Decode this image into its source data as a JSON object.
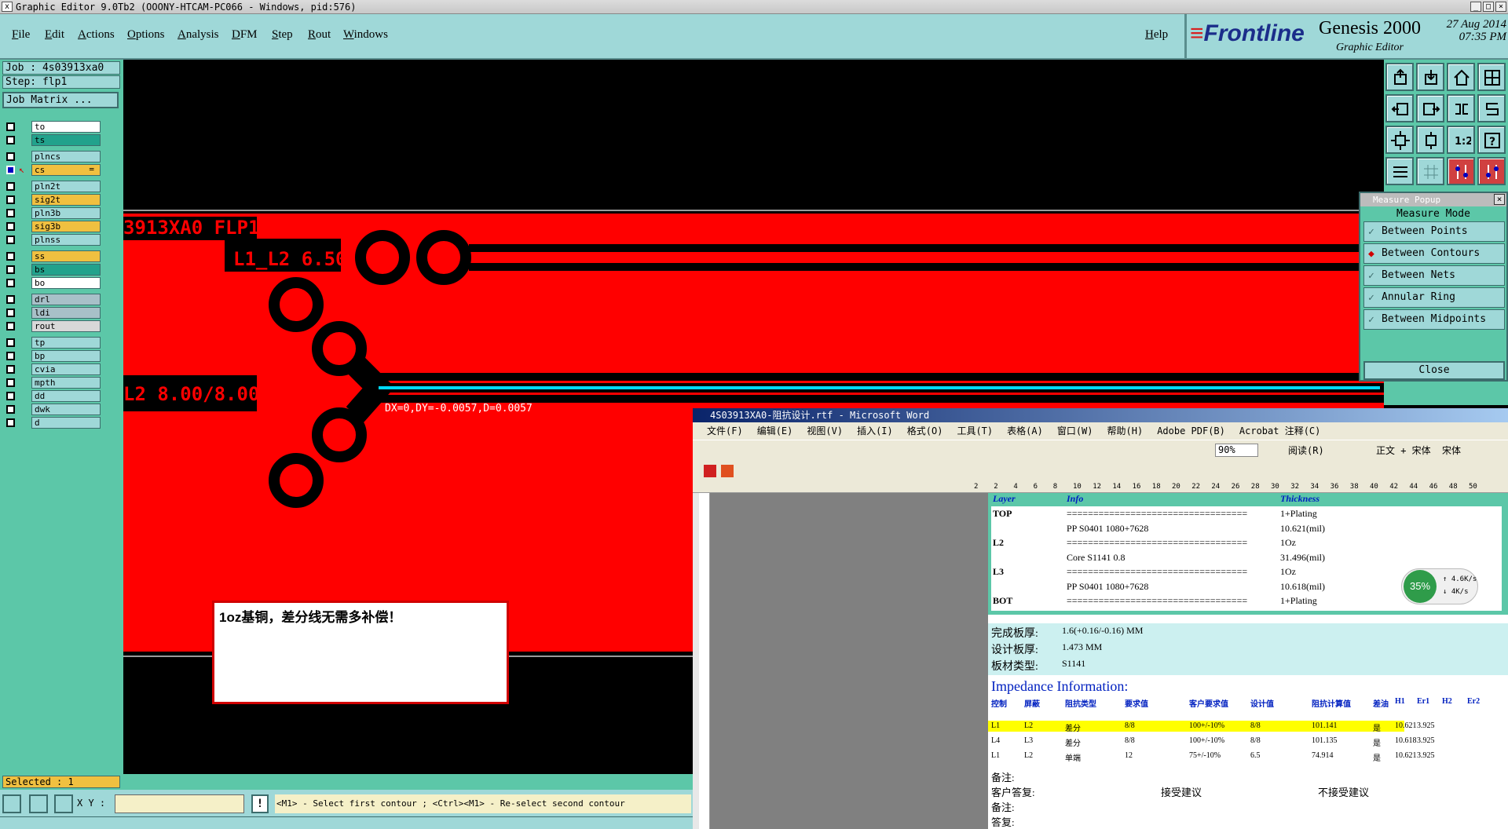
{
  "titlebar": {
    "title": "Graphic Editor 9.0Tb2 (OOONY-HTCAM-PC066 - Windows, pid:576)"
  },
  "menu": {
    "items": [
      "File",
      "Edit",
      "Actions",
      "Options",
      "Analysis",
      "DFM",
      "Step",
      "Rout",
      "Windows"
    ],
    "help": "Help"
  },
  "brand": {
    "logo": "Frontline",
    "product": "Genesis 2000",
    "subtitle": "Graphic Editor",
    "date": "27 Aug 2014",
    "time": "07:35 PM"
  },
  "job": {
    "job_label": "Job : 4s03913xa0",
    "step_label": "Step: flp1",
    "matrix_button": "Job Matrix ..."
  },
  "layers": [
    {
      "name": "to",
      "color": "#ffffff",
      "checked": false
    },
    {
      "name": "ts",
      "color": "#22a28c",
      "checked": false
    },
    {
      "name": "plncs",
      "color": "#9fd8d8",
      "checked": false
    },
    {
      "name": "cs",
      "color": "#f0c040",
      "checked": true,
      "marker": "="
    },
    {
      "name": "pln2t",
      "color": "#9fd8d8",
      "checked": false
    },
    {
      "name": "sig2t",
      "color": "#f0c040",
      "checked": false
    },
    {
      "name": "pln3b",
      "color": "#9fd8d8",
      "checked": false
    },
    {
      "name": "sig3b",
      "color": "#f0c040",
      "checked": false
    },
    {
      "name": "plnss",
      "color": "#9fd8d8",
      "checked": false
    },
    {
      "name": "ss",
      "color": "#f0c040",
      "checked": false
    },
    {
      "name": "bs",
      "color": "#22a28c",
      "checked": false
    },
    {
      "name": "bo",
      "color": "#ffffff",
      "checked": false
    },
    {
      "name": "drl",
      "color": "#a8c0c8",
      "checked": false
    },
    {
      "name": "ldi",
      "color": "#a8c0c8",
      "checked": false
    },
    {
      "name": "rout",
      "color": "#d8d8d8",
      "checked": false
    },
    {
      "name": "tp",
      "color": "#9fd8d8",
      "checked": false
    },
    {
      "name": "bp",
      "color": "#9fd8d8",
      "checked": false
    },
    {
      "name": "cvia",
      "color": "#9fd8d8",
      "checked": false
    },
    {
      "name": "mpth",
      "color": "#9fd8d8",
      "checked": false
    },
    {
      "name": "dd",
      "color": "#9fd8d8",
      "checked": false
    },
    {
      "name": "dwk",
      "color": "#9fd8d8",
      "checked": false
    },
    {
      "name": "d",
      "color": "#9fd8d8",
      "checked": false
    }
  ],
  "status": {
    "selected": "Selected : 1",
    "xy_label": "X Y :",
    "xy_value": "",
    "prompt": "<M1> - Select first contour ; <Ctrl><M1> - Re-select second contour"
  },
  "canvas": {
    "label1": "3913XA0 FLP1",
    "label2": "L1_L2 6.50",
    "label3": "L2 8.00/8.00",
    "measure_readout": "DX=0,DY=-0.0057,D=0.0057",
    "note": "1oz基铜，差分线无需多补偿！"
  },
  "measure_popup": {
    "title": "Measure Popup",
    "mode_label": "Measure Mode",
    "options": [
      "Between Points",
      "Between Contours",
      "Between Nets",
      "Annular Ring",
      "Between Midpoints"
    ],
    "selected": "Between Contours",
    "close": "Close"
  },
  "word": {
    "title": "4S03913XA0-阻抗设计.rtf - Microsoft Word",
    "menu": [
      "文件(F)",
      "编辑(E)",
      "视图(V)",
      "插入(I)",
      "格式(O)",
      "工具(T)",
      "表格(A)",
      "窗口(W)",
      "帮助(H)",
      "Adobe PDF(B)",
      "Acrobat 注释(C)"
    ],
    "zoom": "90%",
    "read": "阅读(R)",
    "style": "正文 + 宋体",
    "font": "宋体",
    "ruler": [
      "2",
      "2",
      "4",
      "6",
      "8",
      "10",
      "12",
      "14",
      "16",
      "18",
      "20",
      "22",
      "24",
      "26",
      "28",
      "30",
      "32",
      "34",
      "36",
      "38",
      "40",
      "42",
      "44",
      "46",
      "48",
      "50"
    ],
    "stack_headers": [
      "Layer",
      "Info",
      "Thickness"
    ],
    "stack_rows": [
      [
        "TOP",
        "==================================",
        "1+Plating"
      ],
      [
        "",
        "PP    S0401     1080+7628",
        "10.621(mil)"
      ],
      [
        "L2",
        "==================================",
        "1Oz"
      ],
      [
        "",
        "Core     S1141     0.8",
        "31.496(mil)"
      ],
      [
        "L3",
        "==================================",
        "1Oz"
      ],
      [
        "",
        "PP    S0401     1080+7628",
        "10.618(mil)"
      ],
      [
        "BOT",
        "==================================",
        "1+Plating"
      ]
    ],
    "board": [
      [
        "完成板厚:",
        "1.6(+0.16/-0.16) MM"
      ],
      [
        "设计板厚:",
        "1.473 MM"
      ],
      [
        "板材类型:",
        "S1141"
      ]
    ],
    "imp_title": "Impedance Information:",
    "imp_headers": [
      "控制",
      "屏蔽",
      "阻抗类型",
      "要求值",
      "客户要求值",
      "设计值",
      "阻抗计算值",
      "差油",
      "H1",
      "Er1",
      "H2",
      "Er2"
    ],
    "imp_rows": [
      [
        "L1",
        "L2",
        "差分",
        "8/8",
        "100+/-10%",
        "8/8",
        "101.141",
        "是",
        "10.621",
        "3.925",
        "",
        ""
      ],
      [
        "L4",
        "L3",
        "差分",
        "8/8",
        "100+/-10%",
        "8/8",
        "101.135",
        "是",
        "10.618",
        "3.925",
        "",
        ""
      ],
      [
        "L1",
        "L2",
        "单端",
        "12",
        "75+/-10%",
        "6.5",
        "74.914",
        "是",
        "10.621",
        "3.925",
        "",
        ""
      ]
    ],
    "remarks": [
      [
        "备注:",
        "",
        ""
      ],
      [
        "客户答复:",
        "接受建议",
        "不接受建议"
      ],
      [
        "备注:",
        "",
        ""
      ],
      [
        "答复:",
        "",
        ""
      ]
    ]
  },
  "net_widget": {
    "percent": "35%",
    "up": "4.6K/s",
    "down": "4K/s"
  }
}
